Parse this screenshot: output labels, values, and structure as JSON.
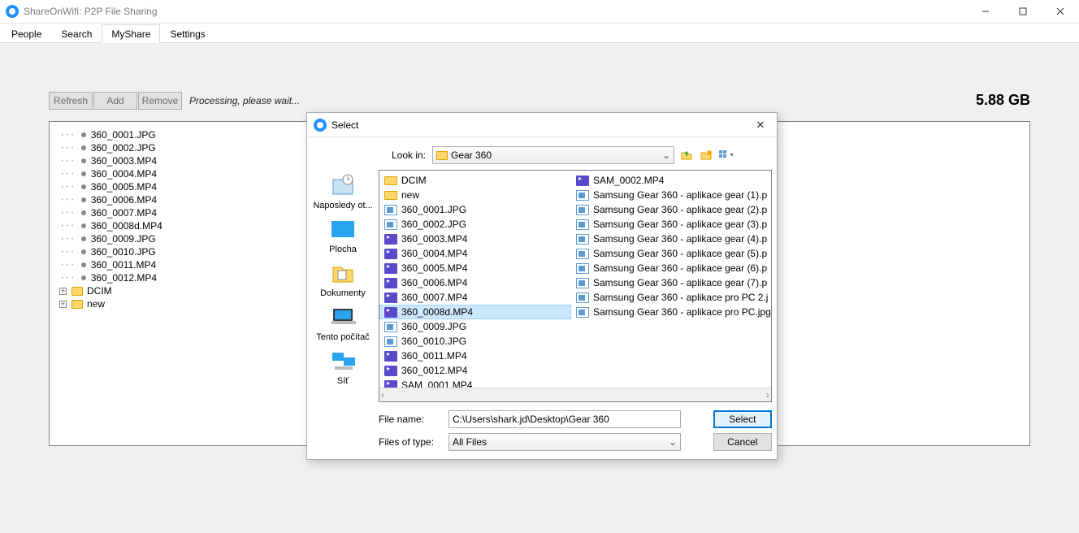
{
  "window": {
    "title": "ShareOnWifi: P2P File Sharing"
  },
  "tabs": [
    "People",
    "Search",
    "MyShare",
    "Settings"
  ],
  "active_tab": 2,
  "toolbar": {
    "refresh": "Refresh",
    "add": "Add",
    "remove": "Remove",
    "status": "Processing, please wait..."
  },
  "total_size": "5.88 GB",
  "tree": {
    "files": [
      "360_0001.JPG",
      "360_0002.JPG",
      "360_0003.MP4",
      "360_0004.MP4",
      "360_0005.MP4",
      "360_0006.MP4",
      "360_0007.MP4",
      "360_0008d.MP4",
      "360_0009.JPG",
      "360_0010.JPG",
      "360_0011.MP4",
      "360_0012.MP4"
    ],
    "folders": [
      "DCIM",
      "new"
    ]
  },
  "dialog": {
    "title": "Select",
    "lookin_label": "Look in:",
    "lookin_value": "Gear 360",
    "places": [
      "Naposledy ot...",
      "Plocha",
      "Dokumenty",
      "Tento počítač",
      "Síť"
    ],
    "col1": [
      {
        "t": "folder",
        "n": "DCIM"
      },
      {
        "t": "folder",
        "n": "new"
      },
      {
        "t": "img",
        "n": "360_0001.JPG"
      },
      {
        "t": "img",
        "n": "360_0002.JPG"
      },
      {
        "t": "mp4",
        "n": "360_0003.MP4"
      },
      {
        "t": "mp4",
        "n": "360_0004.MP4"
      },
      {
        "t": "mp4",
        "n": "360_0005.MP4"
      },
      {
        "t": "mp4",
        "n": "360_0006.MP4"
      },
      {
        "t": "mp4",
        "n": "360_0007.MP4"
      },
      {
        "t": "mp4",
        "n": "360_0008d.MP4",
        "sel": true
      },
      {
        "t": "img",
        "n": "360_0009.JPG"
      },
      {
        "t": "img",
        "n": "360_0010.JPG"
      },
      {
        "t": "mp4",
        "n": "360_0011.MP4"
      },
      {
        "t": "mp4",
        "n": "360_0012.MP4"
      },
      {
        "t": "mp4",
        "n": "SAM_0001.MP4"
      }
    ],
    "col2": [
      {
        "t": "mp4",
        "n": "SAM_0002.MP4"
      },
      {
        "t": "img",
        "n": "Samsung Gear 360 - aplikace gear (1).p"
      },
      {
        "t": "img",
        "n": "Samsung Gear 360 - aplikace gear (2).p"
      },
      {
        "t": "img",
        "n": "Samsung Gear 360 - aplikace gear (3).p"
      },
      {
        "t": "img",
        "n": "Samsung Gear 360 - aplikace gear (4).p"
      },
      {
        "t": "img",
        "n": "Samsung Gear 360 - aplikace gear (5).p"
      },
      {
        "t": "img",
        "n": "Samsung Gear 360 - aplikace gear (6).p"
      },
      {
        "t": "img",
        "n": "Samsung Gear 360 - aplikace gear (7).p"
      },
      {
        "t": "img",
        "n": "Samsung Gear 360 - aplikace pro PC 2.j"
      },
      {
        "t": "img",
        "n": "Samsung Gear 360 - aplikace pro PC.jpg"
      }
    ],
    "filename_label": "File name:",
    "filename_value": "C:\\Users\\shark.jd\\Desktop\\Gear 360",
    "filetype_label": "Files of type:",
    "filetype_value": "All Files",
    "select_btn": "Select",
    "cancel_btn": "Cancel"
  }
}
